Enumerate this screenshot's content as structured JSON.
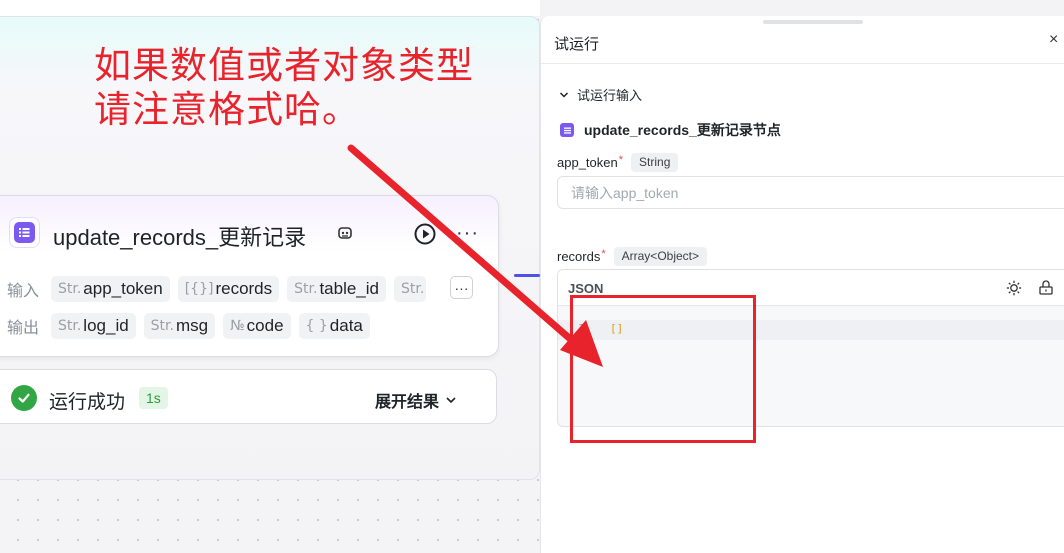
{
  "annotation": {
    "line1": "如果数值或者对象类型",
    "line2": "请注意格式哈。",
    "color": "#e8232b"
  },
  "node": {
    "title": "update_records_更新记录",
    "icon": "list-doc-icon",
    "accent": "#7c5af0",
    "inputs_label": "输入",
    "outputs_label": "输出",
    "inputs": [
      {
        "type": "Str.",
        "name": "app_token"
      },
      {
        "type": "[{}]",
        "name": "records"
      },
      {
        "type": "Str.",
        "name": "table_id"
      },
      {
        "type": "Str."
      }
    ],
    "outputs": [
      {
        "type": "Str.",
        "name": "log_id"
      },
      {
        "type": "Str.",
        "name": "msg"
      },
      {
        "type": "№",
        "name": "code"
      },
      {
        "type": "{ }",
        "name": "data"
      }
    ],
    "more_label": "···"
  },
  "status": {
    "text": "运行成功",
    "duration": "1s",
    "expand_label": "展开结果",
    "color": "#32a645"
  },
  "panel": {
    "title": "试运行",
    "close_label": "×",
    "section_label": "试运行输入",
    "node_name": "update_records_更新记录节点",
    "fields": {
      "app_token": {
        "label": "app_token",
        "required_mark": "*",
        "type": "String",
        "placeholder": "请输入app_token"
      },
      "records": {
        "label": "records",
        "required_mark": "*",
        "type": "Array<Object>",
        "editor_title": "JSON",
        "line_number": "1",
        "value": "[]"
      }
    }
  }
}
